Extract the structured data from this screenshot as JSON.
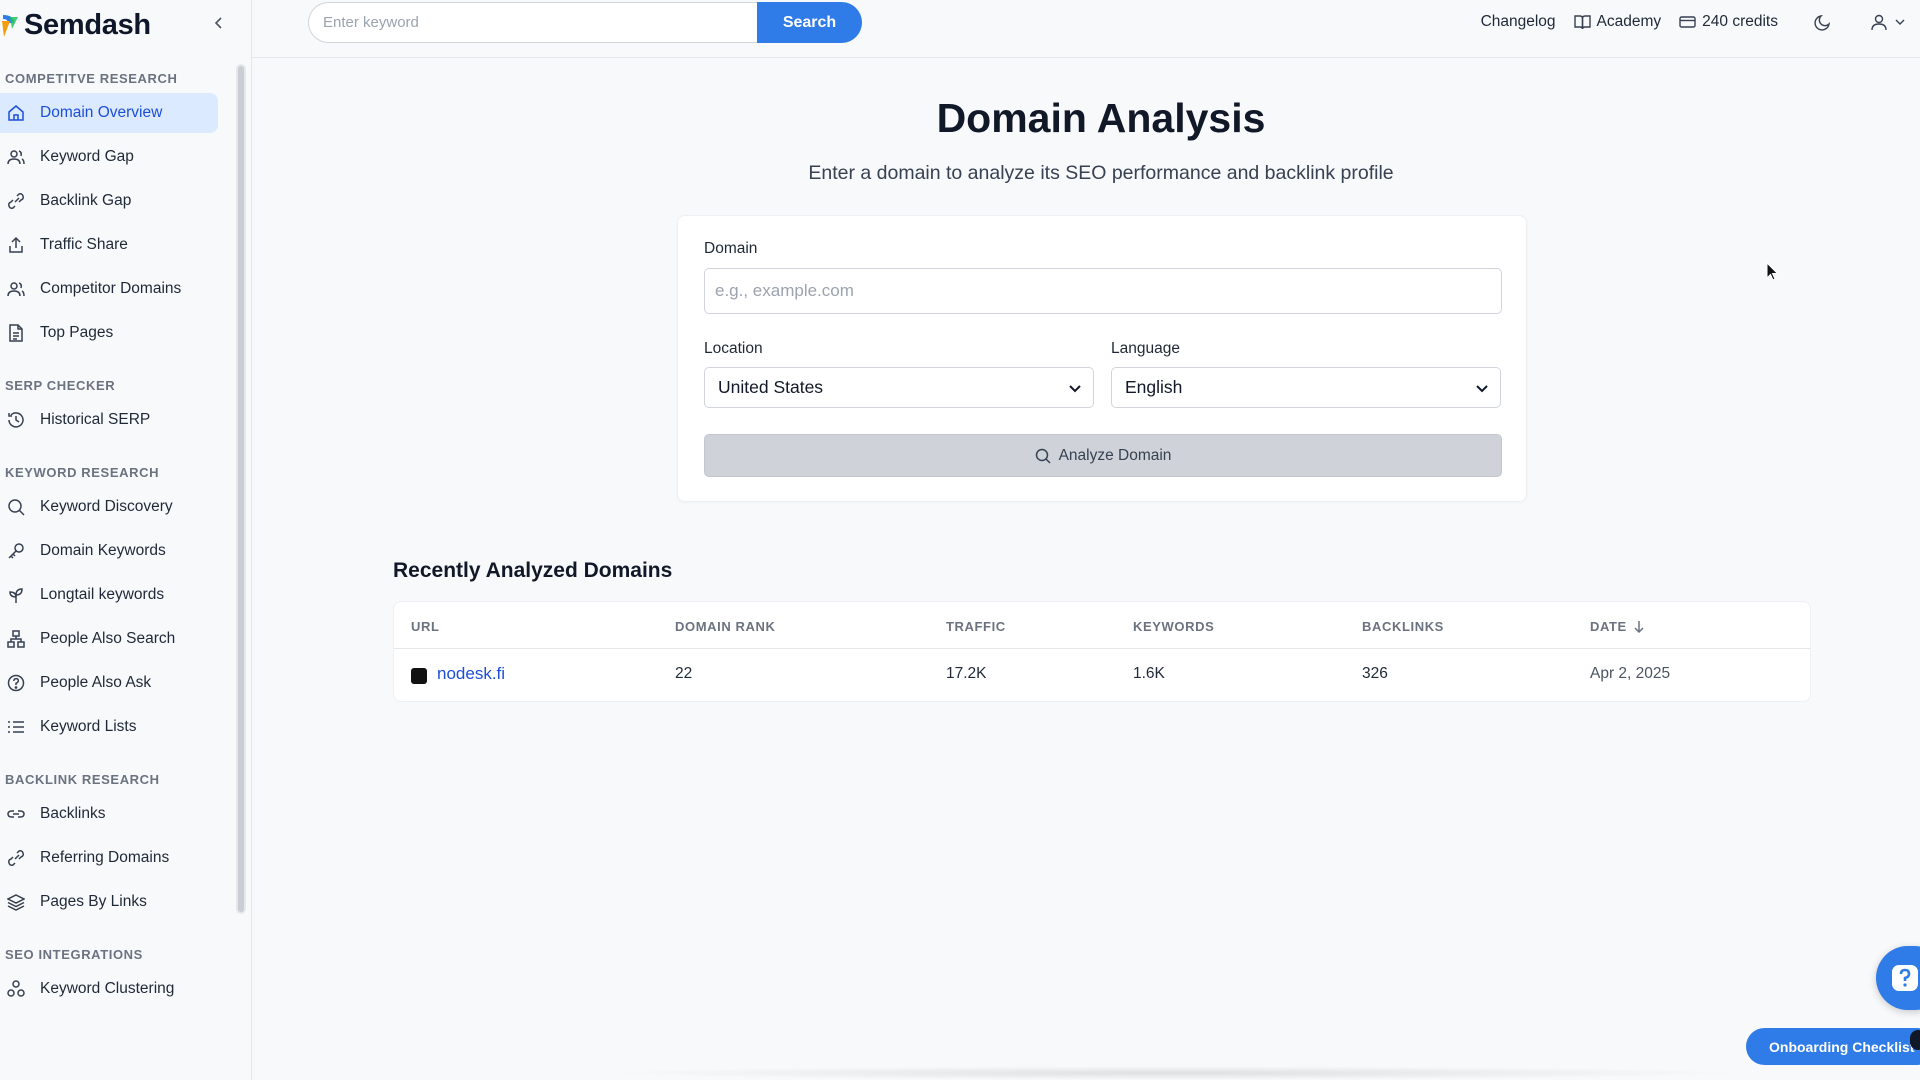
{
  "brand": {
    "name": "Semdash"
  },
  "search": {
    "placeholder": "Enter keyword",
    "button_label": "Search"
  },
  "top_links": {
    "changelog": "Changelog",
    "academy": "Academy",
    "credits": "240 credits"
  },
  "sidebar": {
    "sections": [
      {
        "title": "COMPETITVE RESEARCH",
        "items": [
          {
            "label": "Domain Overview",
            "icon": "home-icon",
            "active": true
          },
          {
            "label": "Keyword Gap",
            "icon": "users-icon"
          },
          {
            "label": "Backlink Gap",
            "icon": "link-icon"
          },
          {
            "label": "Traffic Share",
            "icon": "share-icon"
          },
          {
            "label": "Competitor Domains",
            "icon": "users-icon"
          },
          {
            "label": "Top Pages",
            "icon": "file-icon"
          }
        ]
      },
      {
        "title": "SERP CHECKER",
        "items": [
          {
            "label": "Historical SERP",
            "icon": "history-icon"
          }
        ]
      },
      {
        "title": "KEYWORD RESEARCH",
        "items": [
          {
            "label": "Keyword Discovery",
            "icon": "search-icon"
          },
          {
            "label": "Domain Keywords",
            "icon": "key-icon"
          },
          {
            "label": "Longtail keywords",
            "icon": "sprout-icon"
          },
          {
            "label": "People Also Search",
            "icon": "network-icon"
          },
          {
            "label": "People Also Ask",
            "icon": "help-circle-icon"
          },
          {
            "label": "Keyword Lists",
            "icon": "list-icon"
          }
        ]
      },
      {
        "title": "BACKLINK RESEARCH",
        "items": [
          {
            "label": "Backlinks",
            "icon": "link-icon"
          },
          {
            "label": "Referring Domains",
            "icon": "link-icon"
          },
          {
            "label": "Pages By Links",
            "icon": "layers-icon"
          }
        ]
      },
      {
        "title": "SEO INTEGRATIONS",
        "items": [
          {
            "label": "Keyword Clustering",
            "icon": "cluster-icon"
          }
        ]
      }
    ]
  },
  "main": {
    "title": "Domain Analysis",
    "subtitle": "Enter a domain to analyze its SEO performance and backlink profile",
    "form": {
      "domain_label": "Domain",
      "domain_placeholder": "e.g., example.com",
      "location_label": "Location",
      "location_value": "United States",
      "language_label": "Language",
      "language_value": "English",
      "analyze_label": "Analyze Domain"
    },
    "recent": {
      "title": "Recently Analyzed Domains",
      "columns": [
        "URL",
        "DOMAIN RANK",
        "TRAFFIC",
        "KEYWORDS",
        "BACKLINKS",
        "DATE"
      ],
      "rows": [
        {
          "url": "nodesk.fi",
          "domain_rank": "22",
          "traffic": "17.2K",
          "keywords": "1.6K",
          "backlinks": "326",
          "date": "Apr 2, 2025"
        }
      ]
    }
  },
  "floating": {
    "onboarding_label": "Onboarding Checklist"
  },
  "colors": {
    "accent": "#2f7be7",
    "active_bg": "#dbeafe",
    "active_text": "#1d4ed8",
    "link": "#1d4ed8"
  }
}
